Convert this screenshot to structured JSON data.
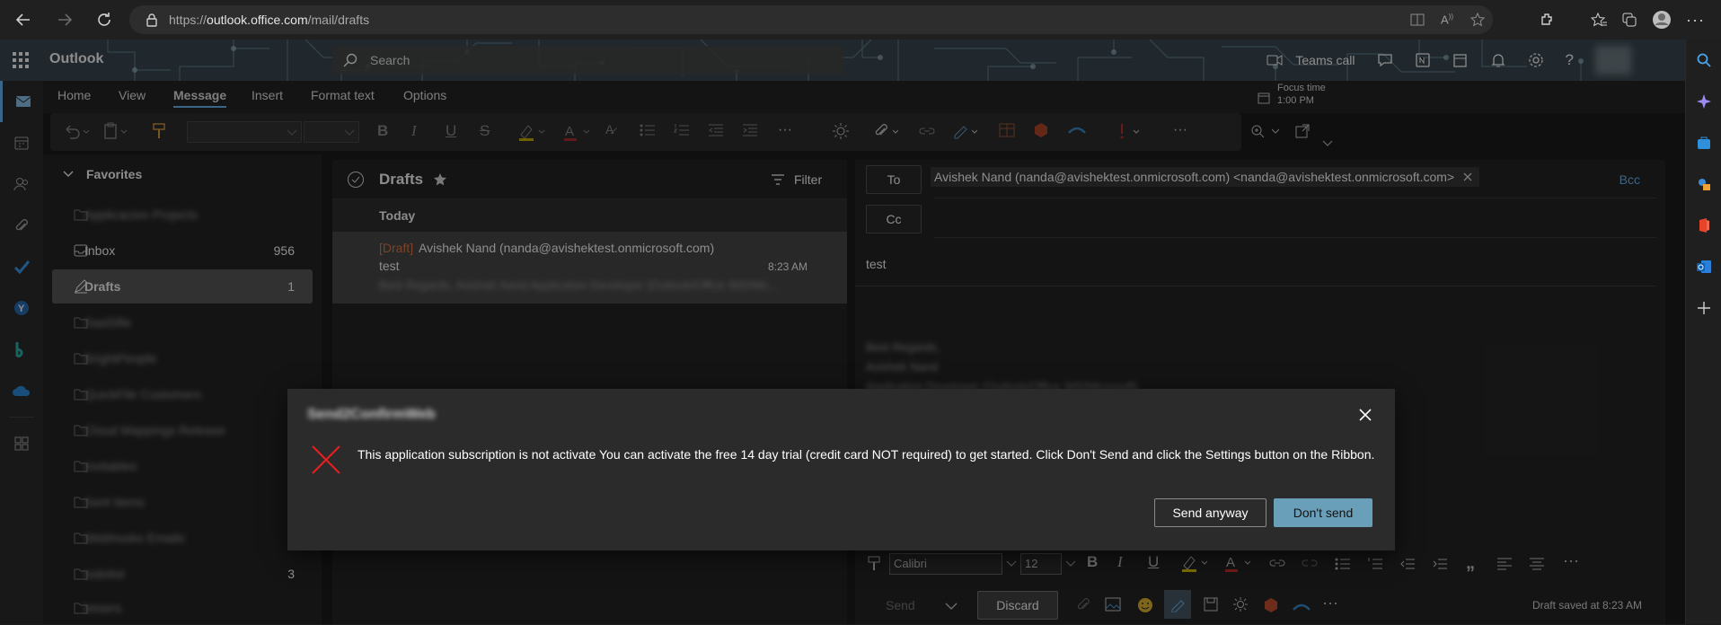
{
  "browser": {
    "url_prefix": "https://",
    "url_domain": "outlook.office.com",
    "url_path": "/mail/drafts"
  },
  "header": {
    "app_name": "Outlook",
    "search_placeholder": "Search",
    "teams_call": "Teams call"
  },
  "ribbon": {
    "tabs": [
      "Home",
      "View",
      "Message",
      "Insert",
      "Format text",
      "Options"
    ],
    "active_tab": "Message",
    "focus_time_label": "Focus time",
    "focus_time_value": "1:00 PM"
  },
  "folders": {
    "favorites_label": "Favorites",
    "items": [
      {
        "label": "Applicacion Projects",
        "count": "",
        "blurred": true
      },
      {
        "label": "Inbox",
        "count": "956",
        "blurred": false
      },
      {
        "label": "Drafts",
        "count": "1",
        "blurred": false,
        "selected": true
      },
      {
        "label": "SaaSifie",
        "count": "",
        "blurred": true
      },
      {
        "label": "BrightPeople",
        "count": "",
        "blurred": true
      },
      {
        "label": "QuickFile Customers",
        "count": "",
        "blurred": true
      },
      {
        "label": "Cloud Mappings Release",
        "count": "",
        "blurred": true
      },
      {
        "label": "invitables",
        "count": "",
        "blurred": true
      },
      {
        "label": "Sent Items",
        "count": "",
        "blurred": true
      },
      {
        "label": "Webhooks Emails",
        "count": "",
        "blurred": true
      },
      {
        "label": "todolist",
        "count": "3",
        "blurred": true
      },
      {
        "label": "letsers",
        "count": "",
        "blurred": true
      }
    ]
  },
  "message_list": {
    "title": "Drafts",
    "filter_label": "Filter",
    "group": "Today",
    "item": {
      "draft_tag": "[Draft]",
      "sender": "Avishek Nand (nanda@avishektest.onmicrosoft.com)",
      "subject": "test",
      "time": "8:23 AM",
      "preview": "Best Regards, Avishek Nand Application Developer (Outlook/Office 365/Mic..."
    }
  },
  "compose": {
    "to_label": "To",
    "cc_label": "Cc",
    "bcc_label": "Bcc",
    "recipient": "Avishek Nand (nanda@avishektest.onmicrosoft.com) <nanda@avishektest.onmicrosoft.com>",
    "subject": "test",
    "signature_lines": [
      "Best Regards,",
      "Avishek Nand",
      "Application Developer (Outlook/Office 365/Microsoft)"
    ],
    "font_name": "Calibri",
    "font_size": "12",
    "send_label": "Send",
    "discard_label": "Discard",
    "status": "Draft saved at 8:23 AM"
  },
  "dialog": {
    "title": "Send2ConfirmWeb",
    "message": "This application subscription is not activate You can activate the free 14 day trial (credit card NOT required) to get started. Click Don't Send and click the Settings button on the Ribbon.",
    "send_anyway": "Send anyway",
    "dont_send": "Don't send",
    "error_color": "#e02020"
  }
}
